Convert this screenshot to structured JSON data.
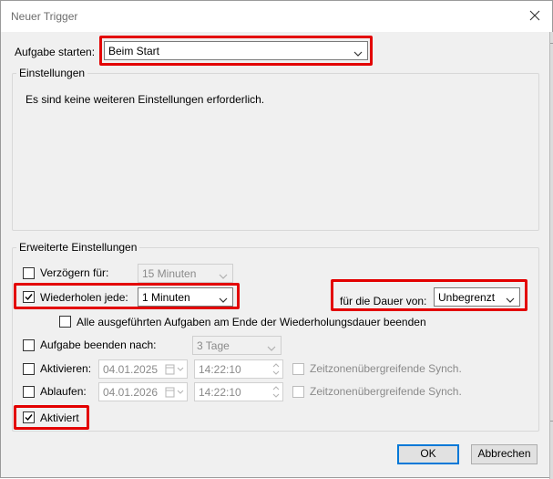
{
  "dialog": {
    "title": "Neuer Trigger"
  },
  "start": {
    "label": "Aufgabe starten:",
    "value": "Beim Start"
  },
  "settings": {
    "group_title": "Einstellungen",
    "message": "Es sind keine weiteren Einstellungen erforderlich."
  },
  "advanced": {
    "group_title": "Erweiterte Einstellungen",
    "delay": {
      "label": "Verzögern für:",
      "checked": false,
      "value": "15 Minuten"
    },
    "repeat": {
      "label": "Wiederholen jede:",
      "checked": true,
      "value": "1 Minuten"
    },
    "duration": {
      "label": "für die Dauer von:",
      "value": "Unbegrenzt"
    },
    "stop_all": {
      "label": "Alle ausgeführten Aufgaben am Ende der Wiederholungsdauer beenden",
      "checked": false
    },
    "stop_after": {
      "label": "Aufgabe beenden nach:",
      "checked": false,
      "value": "3 Tage"
    },
    "activate": {
      "label": "Aktivieren:",
      "checked": false,
      "date": "04.01.2025",
      "time": "14:22:10",
      "sync_label": "Zeitzonenübergreifende Synch."
    },
    "expire": {
      "label": "Ablaufen:",
      "checked": false,
      "date": "04.01.2026",
      "time": "14:22:10",
      "sync_label": "Zeitzonenübergreifende Synch."
    },
    "enabled": {
      "label": "Aktiviert",
      "checked": true
    }
  },
  "buttons": {
    "ok": "OK",
    "cancel": "Abbrechen"
  },
  "colors": {
    "highlight": "#e30000",
    "accent": "#0078d7",
    "dialog_bg": "#f0f0f0"
  },
  "icons": {
    "close": "close-icon",
    "dropdown": "chevron-down-icon",
    "calendar": "calendar-icon",
    "spinner": "spin-arrows-icon",
    "checkmark": "checkmark-icon"
  }
}
